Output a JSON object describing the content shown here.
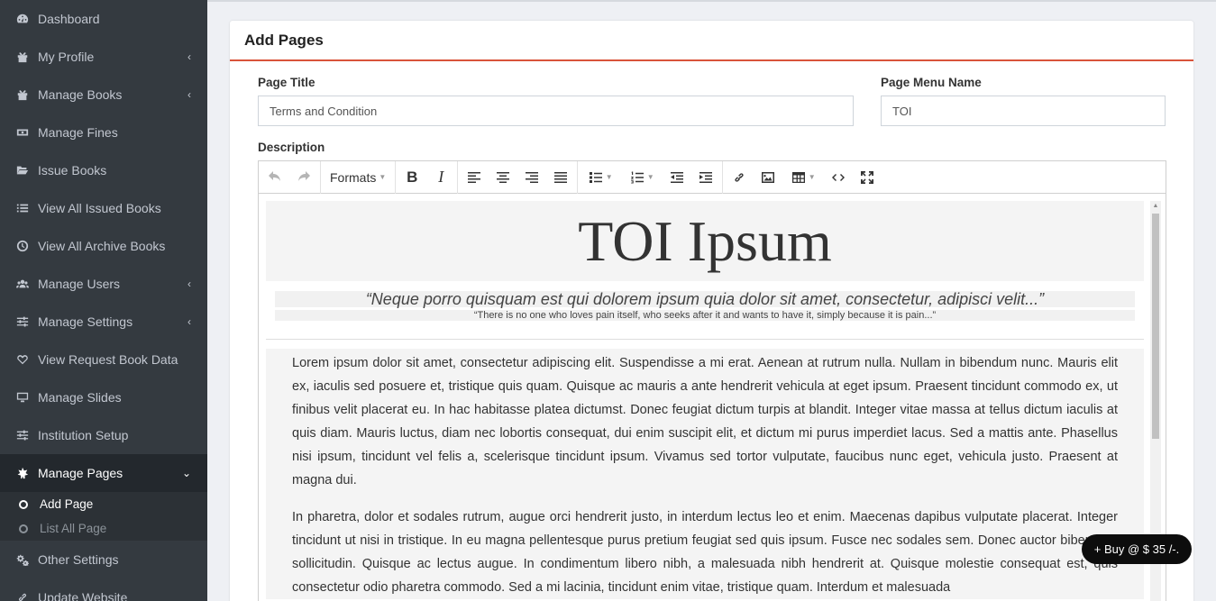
{
  "sidebar": {
    "items": [
      {
        "label": "Dashboard",
        "icon": "dashboard-icon"
      },
      {
        "label": "My Profile",
        "icon": "gift-icon"
      },
      {
        "label": "Manage Books",
        "icon": "gift-icon"
      },
      {
        "label": "Manage Fines",
        "icon": "money-icon"
      },
      {
        "label": "Issue Books",
        "icon": "folder-open-icon"
      },
      {
        "label": "View All Issued Books",
        "icon": "list-icon"
      },
      {
        "label": "View All Archive Books",
        "icon": "clock-icon"
      },
      {
        "label": "Manage Users",
        "icon": "users-icon"
      },
      {
        "label": "Manage Settings",
        "icon": "sliders-icon"
      },
      {
        "label": "View Request Book Data",
        "icon": "heart-icon"
      },
      {
        "label": "Manage Slides",
        "icon": "desktop-icon"
      },
      {
        "label": "Institution Setup",
        "icon": "sliders-icon"
      },
      {
        "label": "Manage Pages",
        "icon": "leaf-icon"
      },
      {
        "label": "Other Settings",
        "icon": "cogs-icon"
      },
      {
        "label": "Update Website",
        "icon": "link-icon"
      }
    ],
    "subitems": [
      {
        "label": "Add Page"
      },
      {
        "label": "List All Page"
      }
    ]
  },
  "main": {
    "card_title": "Add Pages",
    "page_title_label": "Page Title",
    "page_title_value": "Terms and Condition",
    "menu_name_label": "Page Menu Name",
    "menu_name_value": "TOI",
    "description_label": "Description"
  },
  "editor": {
    "formats_label": "Formats",
    "content": {
      "heading": "TOI Ipsum",
      "quote": "“Neque porro quisquam est qui dolorem ipsum quia dolor sit amet, consectetur, adipisci velit...”",
      "subquote": "“There is no one who loves pain itself, who seeks after it and wants to have it, simply because it is pain...”",
      "paragraphs": [
        "Lorem ipsum dolor sit amet, consectetur adipiscing elit. Suspendisse a mi erat. Aenean at rutrum nulla. Nullam in bibendum nunc. Mauris elit ex, iaculis sed posuere et, tristique quis quam. Quisque ac mauris a ante hendrerit vehicula at eget ipsum. Praesent tincidunt commodo ex, ut finibus velit placerat eu. In hac habitasse platea dictumst. Donec feugiat dictum turpis at blandit. Integer vitae massa at tellus dictum iaculis at quis diam. Mauris luctus, diam nec lobortis consequat, dui enim suscipit elit, et dictum mi purus imperdiet lacus. Sed a mattis ante. Phasellus nisi ipsum, tincidunt vel felis a, scelerisque tincidunt ipsum. Vivamus sed tortor vulputate, faucibus nunc eget, vehicula justo. Praesent at magna dui.",
        "In pharetra, dolor et sodales rutrum, augue orci hendrerit justo, in interdum lectus leo et enim. Maecenas dapibus vulputate placerat. Integer tincidunt ut nisi in tristique. In eu magna pellentesque purus pretium feugiat sed quis ipsum. Fusce nec sodales sem. Donec auctor bibendum sollicitudin. Quisque ac lectus augue. In condimentum libero nibh, a malesuada nibh hendrerit at. Quisque molestie consequat est, quis consectetur odio pharetra commodo. Sed a mi lacinia, tincidunt enim vitae, tristique quam. Interdum et malesuada"
      ]
    }
  },
  "buy_button": "+ Buy @ $ 35 /-.",
  "colors": {
    "sidebar_bg": "#343a40",
    "accent": "#d9533a"
  }
}
